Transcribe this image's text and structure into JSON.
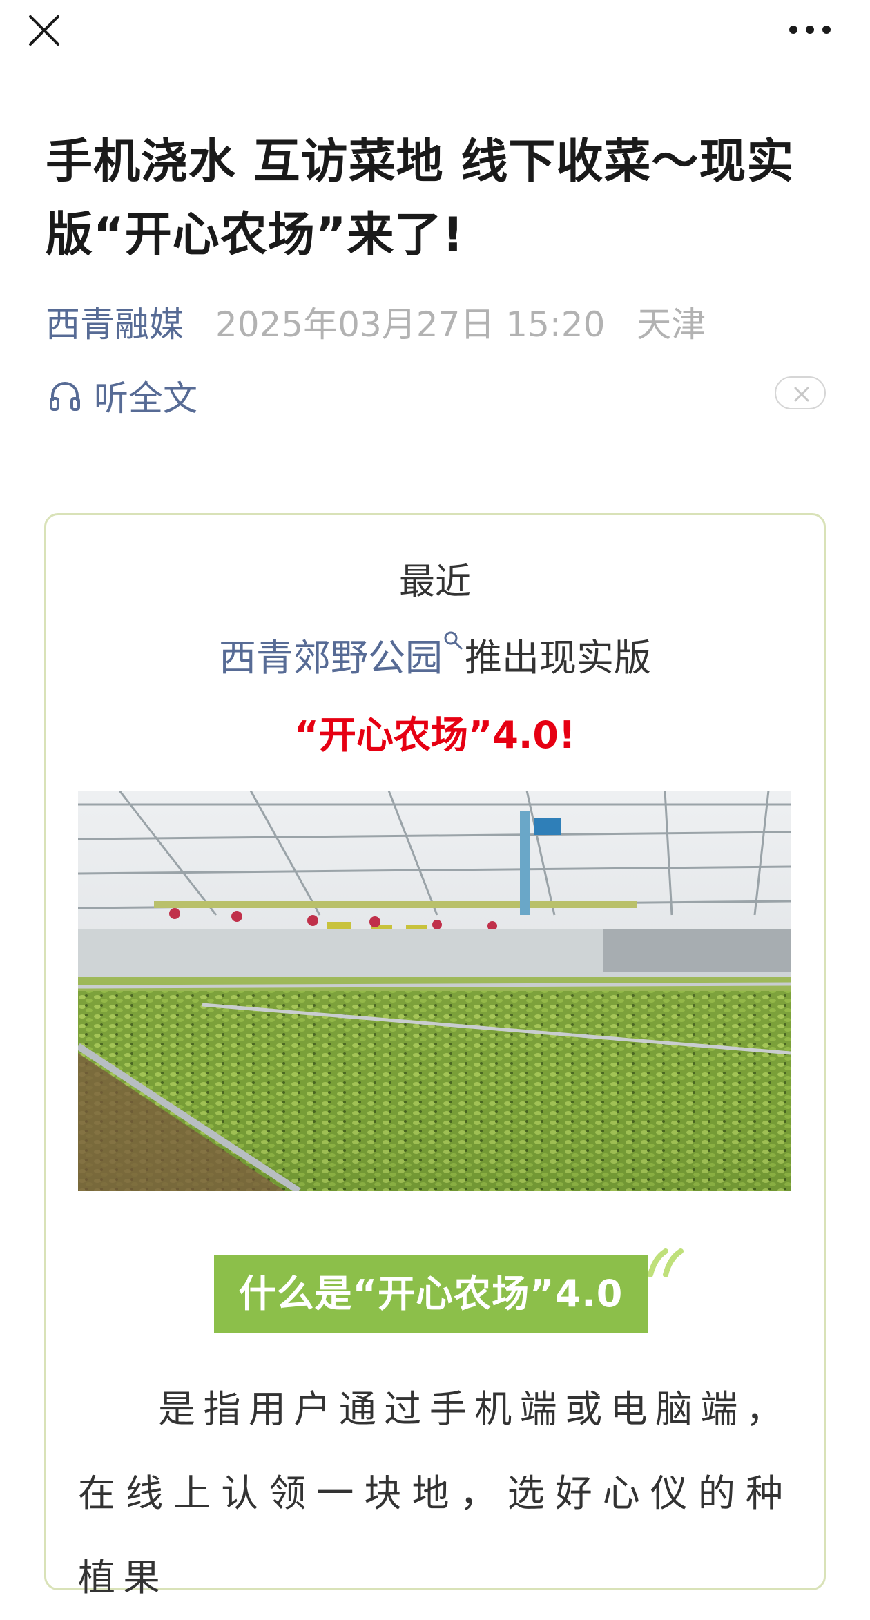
{
  "toolbar": {
    "close_icon": "close-icon",
    "more_icon": "more-icon"
  },
  "article": {
    "title": "手机浇水 互访菜地 线下收菜～现实版“开心农场”来了!",
    "author": "西青融媒",
    "datetime": "2025年03月27日 15:20",
    "location": "天津",
    "listen_label": "听全文"
  },
  "card": {
    "intro_line1": "最近",
    "park_link": "西青郊野公园",
    "intro_line2_rest": "推出现实版",
    "highlight": "“开心农场”4.0!",
    "photo_icon": "greenhouse-seedlings-photo",
    "section_heading": "什么是“开心农场”4.0",
    "paragraph": "是指用户通过手机端或电脑端，在线上认领一块地，选好心仪的种植果"
  },
  "colors": {
    "link": "#576b95",
    "meta_gray": "#b2b2b2",
    "highlight_red": "#e60012",
    "banner_green": "#8cbf4a",
    "card_border": "#d9e2b8"
  }
}
